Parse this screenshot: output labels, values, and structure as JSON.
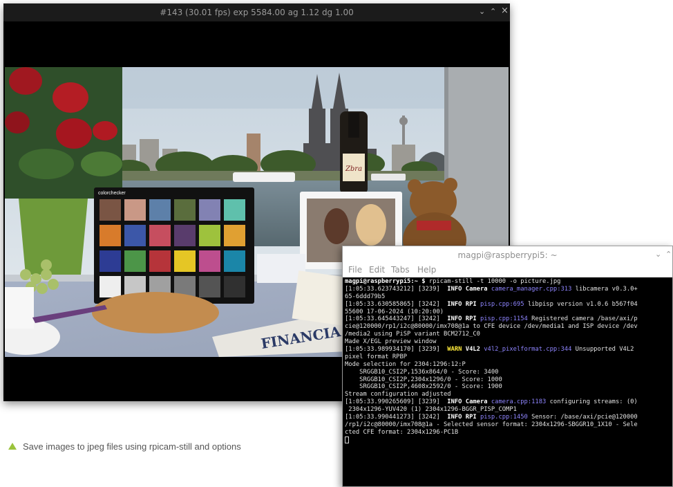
{
  "preview": {
    "title": "#143 (30.01 fps) exp 5584.00 ag 1.12 dg 1.00",
    "controls": {
      "minimize": "⌄",
      "maximize": "⌃",
      "close": "×"
    },
    "photo": {
      "bottle_label": "Zbra",
      "newspaper": "FINANCIA",
      "chart_brand": "colorchecker",
      "chart_colors": [
        "#7a5544",
        "#c99886",
        "#5d80a9",
        "#5a6d3d",
        "#8282b3",
        "#5fc0ac",
        "#d87b2b",
        "#3c57a8",
        "#c64e5f",
        "#593c6c",
        "#9ec23d",
        "#e0a032",
        "#2d3c94",
        "#4c9548",
        "#b6343a",
        "#e5c625",
        "#bd4e8e",
        "#1b86a8",
        "#eeeeee",
        "#c6c6c6",
        "#a0a0a0",
        "#7a7a7a",
        "#545454",
        "#303030"
      ]
    }
  },
  "terminal": {
    "title": "magpi@raspberrypi5: ~",
    "controls": {
      "minimize": "⌄",
      "maximize": "⌃"
    },
    "menu": [
      "File",
      "Edit",
      "Tabs",
      "Help"
    ],
    "lines": [
      [
        {
          "t": "magpi@raspberrypi5:~ $ ",
          "c": "prompt"
        },
        {
          "t": "rpicam-still -t 10000 -o picture.jpg"
        }
      ],
      [
        {
          "t": "[1:05:33.623743212] [3239]  "
        },
        {
          "t": "INFO ",
          "c": "info"
        },
        {
          "t": "Camera ",
          "c": "cat"
        },
        {
          "t": "camera_manager.cpp:313",
          "c": "src"
        },
        {
          "t": " libcamera v0.3.0+"
        }
      ],
      [
        {
          "t": "65-6ddd79b5"
        }
      ],
      [
        {
          "t": "[1:05:33.630585865] [3242]  "
        },
        {
          "t": "INFO ",
          "c": "info"
        },
        {
          "t": "RPI ",
          "c": "cat"
        },
        {
          "t": "pisp.cpp:695",
          "c": "src"
        },
        {
          "t": " libpisp version v1.0.6 b567f04"
        }
      ],
      [
        {
          "t": "55600 17-06-2024 (10:20:00)"
        }
      ],
      [
        {
          "t": "[1:05:33.645443247] [3242]  "
        },
        {
          "t": "INFO ",
          "c": "info"
        },
        {
          "t": "RPI ",
          "c": "cat"
        },
        {
          "t": "pisp.cpp:1154",
          "c": "src"
        },
        {
          "t": " Registered camera /base/axi/p"
        }
      ],
      [
        {
          "t": "cie@120000/rp1/i2c@80000/imx708@1a to CFE device /dev/media1 and ISP device /dev"
        }
      ],
      [
        {
          "t": "/media2 using PiSP variant BCM2712_C0"
        }
      ],
      [
        {
          "t": "Made X/EGL preview window"
        }
      ],
      [
        {
          "t": "[1:05:33.989934170] [3239]  "
        },
        {
          "t": "WARN ",
          "c": "warn"
        },
        {
          "t": "V4L2 ",
          "c": "cat"
        },
        {
          "t": "v4l2_pixelformat.cpp:344",
          "c": "src"
        },
        {
          "t": " Unsupported V4L2"
        }
      ],
      [
        {
          "t": "pixel format RPBP"
        }
      ],
      [
        {
          "t": "Mode selection for 2304:1296:12:P"
        }
      ],
      [
        {
          "t": "    SRGGB10_CSI2P,1536x864/0 - Score: 3400"
        }
      ],
      [
        {
          "t": "    SRGGB10_CSI2P,2304x1296/0 - Score: 1000"
        }
      ],
      [
        {
          "t": "    SRGGB10_CSI2P,4608x2592/0 - Score: 1900"
        }
      ],
      [
        {
          "t": "Stream configuration adjusted"
        }
      ],
      [
        {
          "t": "[1:05:33.990265609] [3239]  "
        },
        {
          "t": "INFO ",
          "c": "info"
        },
        {
          "t": "Camera ",
          "c": "cat"
        },
        {
          "t": "camera.cpp:1183",
          "c": "src"
        },
        {
          "t": " configuring streams: (0)"
        }
      ],
      [
        {
          "t": " 2304x1296-YUV420 (1) 2304x1296-BGGR_PISP_COMP1"
        }
      ],
      [
        {
          "t": "[1:05:33.990441273] [3242]  "
        },
        {
          "t": "INFO ",
          "c": "info"
        },
        {
          "t": "RPI ",
          "c": "cat"
        },
        {
          "t": "pisp.cpp:1450",
          "c": "src"
        },
        {
          "t": " Sensor: /base/axi/pcie@120000"
        }
      ],
      [
        {
          "t": "/rp1/i2c@80000/imx708@1a - Selected sensor format: 2304x1296-SBGGR10_1X10 - Sele"
        }
      ],
      [
        {
          "t": "cted CFE format: 2304x1296-PC1B"
        }
      ]
    ]
  },
  "caption": {
    "text": "Save images to jpeg files using rpicam-still and options",
    "marker_color": "#9bc33c"
  }
}
